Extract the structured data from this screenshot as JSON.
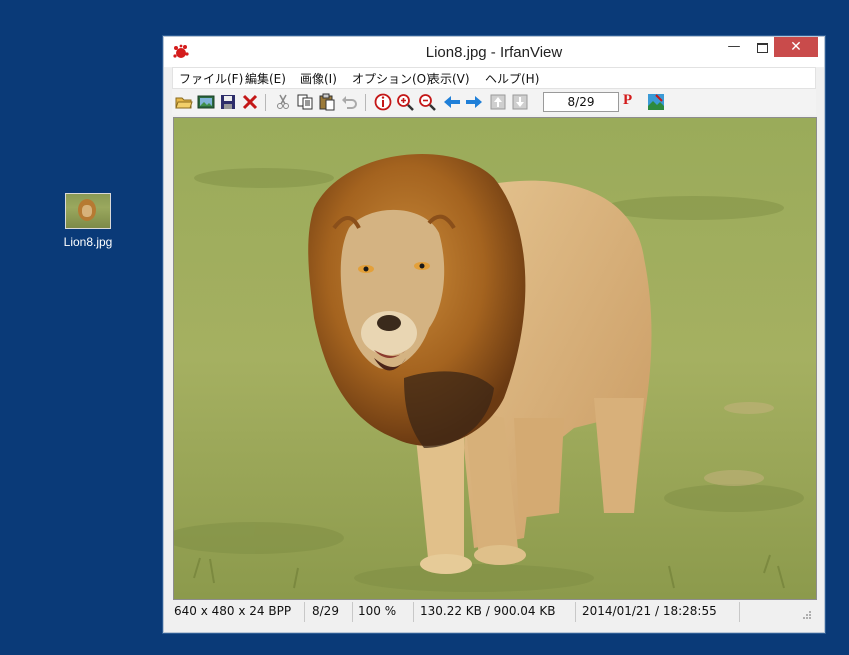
{
  "desktop": {
    "icon_label": "Lion8.jpg"
  },
  "window": {
    "title": "Lion8.jpg - IrfanView",
    "controls": {
      "minimize": "—",
      "close": "✕"
    }
  },
  "menu": {
    "file": "ファイル(F)",
    "edit": "編集(E)",
    "image": "画像(I)",
    "options": "オプション(O)",
    "view": "表示(V)",
    "help": "ヘルプ(H)"
  },
  "toolbar": {
    "icons": [
      "open-folder",
      "slideshow",
      "save",
      "delete",
      "cut",
      "copy",
      "paste",
      "undo",
      "info",
      "zoom-in",
      "zoom-out",
      "previous",
      "next",
      "first",
      "last",
      "print",
      "paint"
    ],
    "page_indicator": "8/29",
    "p_label": "P"
  },
  "status": {
    "dimensions": "640 x 480 x 24 BPP",
    "index": "8/29",
    "zoom": "100 %",
    "filesize": "130.22 KB / 900.04 KB",
    "datetime": "2014/01/21 / 18:28:55"
  },
  "colors": {
    "desktop": "#0a3a78",
    "close_button": "#c94b4b",
    "arrow_blue": "#1f7fd8"
  }
}
